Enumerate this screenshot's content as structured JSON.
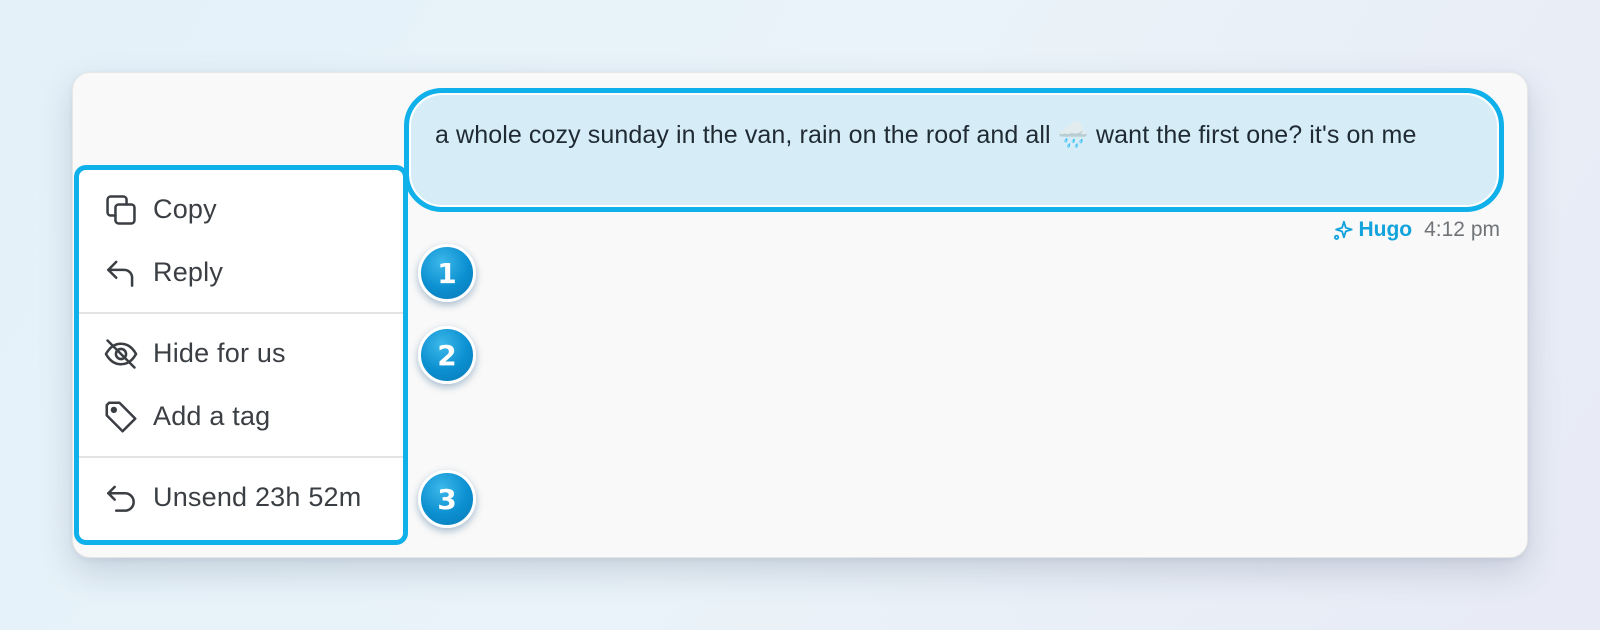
{
  "message": {
    "text": "a whole cozy sunday in the van, rain on the roof and all 🌧️ want the first one? it's on me",
    "sender": "Hugo",
    "sender_icon": "sparkle-icon",
    "time": "4:12 pm"
  },
  "context_menu": {
    "items": [
      {
        "label": "Copy",
        "icon": "copy-icon"
      },
      {
        "label": "Reply",
        "icon": "reply-icon"
      },
      {
        "label": "Hide for us",
        "icon": "eye-off-icon"
      },
      {
        "label": "Add a tag",
        "icon": "tag-icon"
      },
      {
        "label": "Unsend 23h 52m",
        "icon": "undo-icon"
      }
    ]
  },
  "annotations": [
    "1",
    "2",
    "3"
  ],
  "colors": {
    "highlight": "#10b0ea",
    "bubble_bg": "#d6edf7",
    "accent": "#12a3dc",
    "badge": "#0b8fd0"
  }
}
